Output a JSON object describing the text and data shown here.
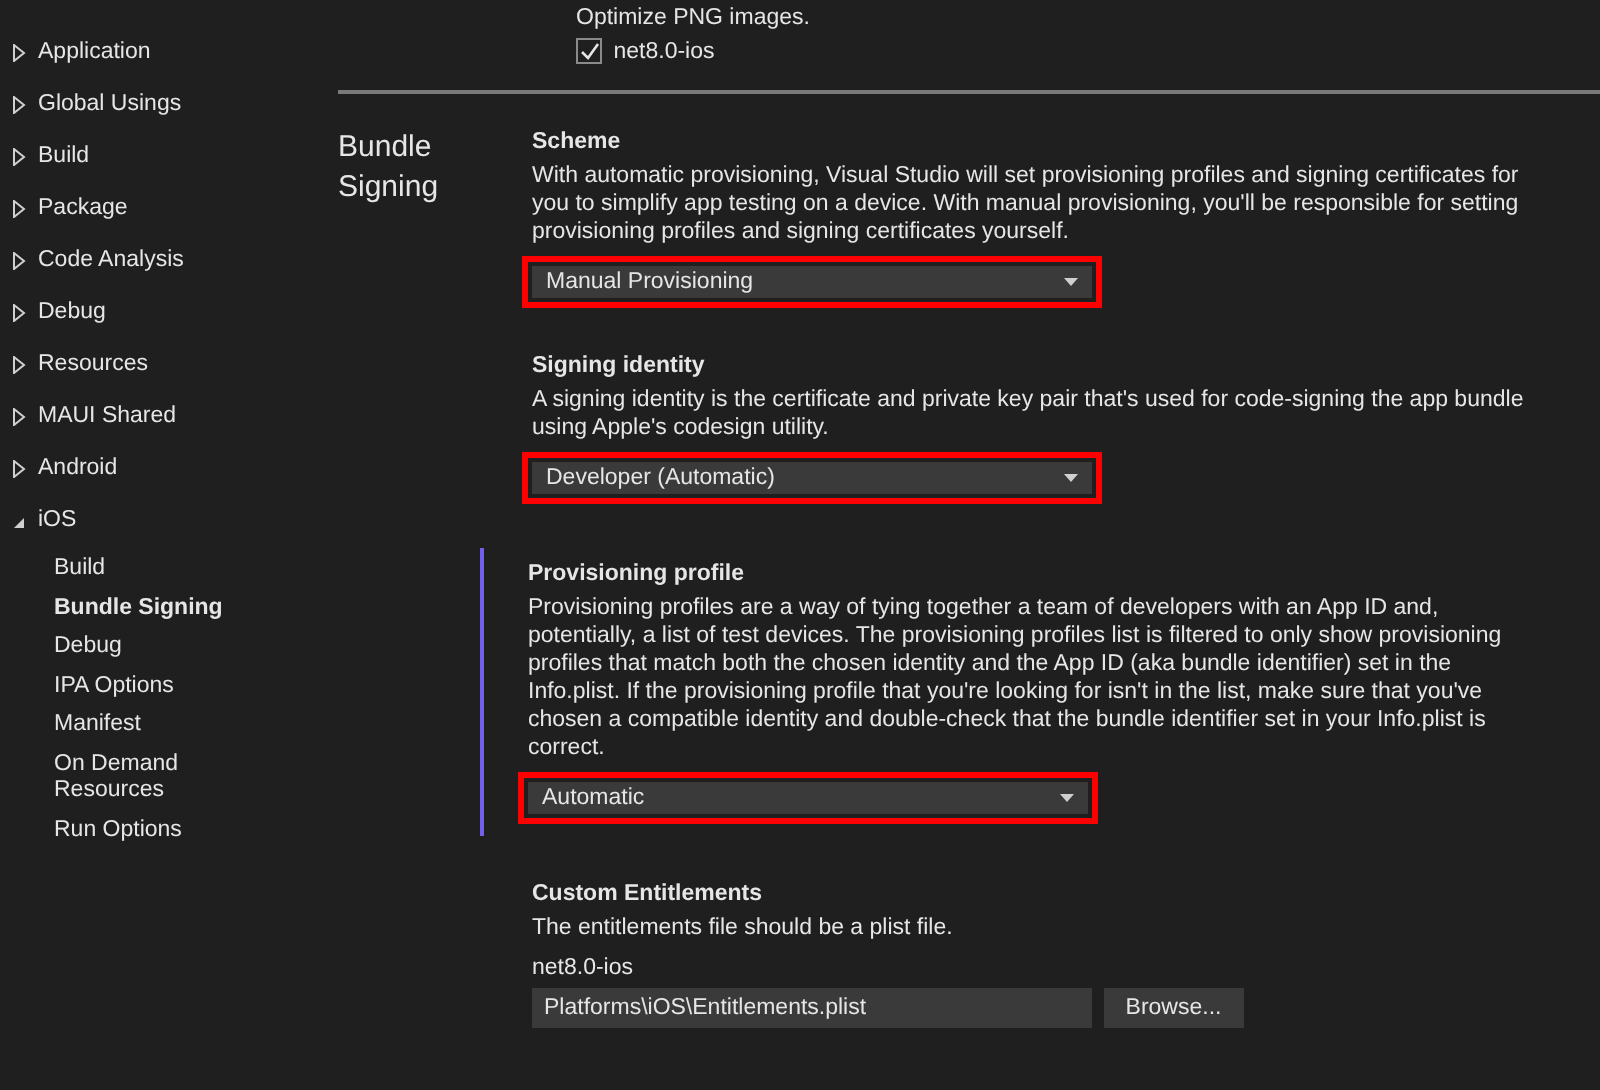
{
  "sidebar": {
    "items": [
      {
        "label": "Application",
        "expanded": false
      },
      {
        "label": "Global Usings",
        "expanded": false
      },
      {
        "label": "Build",
        "expanded": false
      },
      {
        "label": "Package",
        "expanded": false
      },
      {
        "label": "Code Analysis",
        "expanded": false
      },
      {
        "label": "Debug",
        "expanded": false
      },
      {
        "label": "Resources",
        "expanded": false
      },
      {
        "label": "MAUI Shared",
        "expanded": false
      },
      {
        "label": "Android",
        "expanded": false
      },
      {
        "label": "iOS",
        "expanded": true,
        "children": [
          {
            "label": "Build",
            "selected": false
          },
          {
            "label": "Bundle Signing",
            "selected": true
          },
          {
            "label": "Debug",
            "selected": false
          },
          {
            "label": "IPA Options",
            "selected": false
          },
          {
            "label": "Manifest",
            "selected": false
          },
          {
            "label": "On Demand Resources",
            "selected": false
          },
          {
            "label": "Run Options",
            "selected": false
          }
        ]
      }
    ]
  },
  "previous_setting": {
    "description": "Optimize PNG images.",
    "checkbox": {
      "label": "net8.0-ios",
      "checked": true
    }
  },
  "section": {
    "title": "Bundle Signing",
    "settings": [
      {
        "kind": "dropdown",
        "label": "Scheme",
        "description": "With automatic provisioning, Visual Studio will set provisioning profiles and signing certificates for you to simplify app testing on a device. With manual provisioning, you'll be responsible for setting provisioning profiles and signing certificates yourself.",
        "value": "Manual Provisioning",
        "highlighted": true,
        "focused": false
      },
      {
        "kind": "dropdown",
        "label": "Signing identity",
        "description": "A signing identity is the certificate and private key pair that's used for code-signing the app bundle using Apple's codesign utility.",
        "value": "Developer (Automatic)",
        "highlighted": true,
        "focused": false
      },
      {
        "kind": "dropdown",
        "label": "Provisioning profile",
        "description": "Provisioning profiles are a way of tying together a team of developers with an App ID and, potentially, a list of test devices. The provisioning profiles list is filtered to only show provisioning profiles that match both the chosen identity and the App ID (aka bundle identifier) set in the Info.plist. If the provisioning profile that you're looking for isn't in the list, make sure that you've chosen a compatible identity and double-check that the bundle identifier set in your Info.plist is correct.",
        "value": "Automatic",
        "highlighted": true,
        "focused": true
      },
      {
        "kind": "file",
        "label": "Custom Entitlements",
        "description": "The entitlements file should be a plist file.",
        "target": "net8.0-ios",
        "value": "Platforms\\iOS\\Entitlements.plist",
        "button": "Browse..."
      }
    ]
  }
}
